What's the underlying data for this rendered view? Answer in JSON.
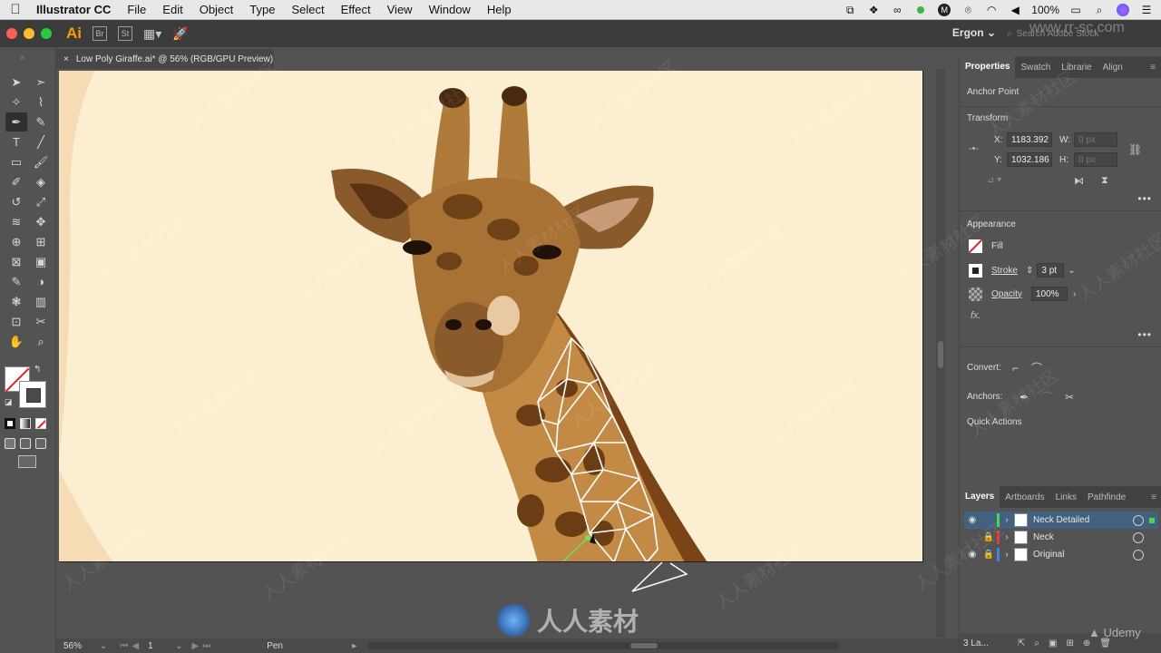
{
  "menubar": {
    "apple": "",
    "app_name": "Illustrator CC",
    "items": [
      "File",
      "Edit",
      "Object",
      "Type",
      "Select",
      "Effect",
      "View",
      "Window",
      "Help"
    ],
    "battery": "100%"
  },
  "appbar": {
    "logo": "Ai",
    "bridge": "Br",
    "stock": "St",
    "workspace": "Ergon",
    "search_placeholder": "Search Adobe Stock"
  },
  "document": {
    "tab_title": "Low Poly Giraffe.ai* @ 56% (RGB/GPU Preview)",
    "close": "×"
  },
  "toolbar": {
    "tools": [
      "selection-icon",
      "direct-selection-icon",
      "magic-wand-icon",
      "lasso-icon",
      "pen-icon",
      "curvature-icon",
      "type-icon",
      "line-icon",
      "rectangle-icon",
      "paintbrush-icon",
      "shaper-icon",
      "eraser-icon",
      "rotate-icon",
      "scale-icon",
      "width-icon",
      "puppet-warp-icon",
      "shape-builder-icon",
      "perspective-icon",
      "mesh-icon",
      "gradient-icon",
      "eyedropper-icon",
      "blend-icon",
      "symbol-sprayer-icon",
      "graph-icon",
      "artboard-icon",
      "slice-icon",
      "hand-icon",
      "zoom-icon"
    ],
    "glyphs": [
      "➤",
      "➣",
      "✧",
      "⌇",
      "✒",
      "✎",
      "T",
      "╱",
      "▭",
      "🖌",
      "✐",
      "◈",
      "↺",
      "⤢",
      "≋",
      "✥",
      "⊕",
      "⊞",
      "⊠",
      "▣",
      "✎",
      "◑",
      "❃",
      "▥",
      "⊡",
      "✂",
      "✋",
      "⌕"
    ]
  },
  "properties": {
    "tabs": [
      "Properties",
      "Swatches",
      "Libraries",
      "Align"
    ],
    "tabs_shown": [
      "Properties",
      "Swatch",
      "Librarie",
      "Align"
    ],
    "object_type": "Anchor Point",
    "transform": {
      "title": "Transform",
      "x_label": "X:",
      "x_value": "1183.392",
      "y_label": "Y:",
      "y_value": "1032.186",
      "w_label": "W:",
      "w_value": "0 px",
      "h_label": "H:",
      "h_value": "0 px"
    },
    "appearance": {
      "title": "Appearance",
      "fill_label": "Fill",
      "stroke_label": "Stroke",
      "stroke_value": "3 pt",
      "opacity_label": "Opacity",
      "opacity_value": "100%",
      "fx": "fx."
    },
    "convert_label": "Convert:",
    "anchors_label": "Anchors:",
    "quick_actions": "Quick Actions",
    "more": "•••"
  },
  "layers": {
    "tabs": [
      "Layers",
      "Artboards",
      "Links",
      "Pathfinder"
    ],
    "tabs_shown": [
      "Layers",
      "Artboards",
      "Links",
      "Pathfinde"
    ],
    "items": [
      {
        "name": "Neck Detailed",
        "color": "#4fd24f",
        "visible": true,
        "locked": false,
        "selected": true
      },
      {
        "name": "Neck",
        "color": "#e23b3b",
        "visible": false,
        "locked": true,
        "selected": false
      },
      {
        "name": "Original",
        "color": "#4a7fe0",
        "visible": true,
        "locked": true,
        "selected": false
      }
    ],
    "count": "3 La..."
  },
  "statusbar": {
    "zoom": "56%",
    "artboard": "1",
    "tool": "Pen"
  },
  "watermark": {
    "text": "人人素材社区",
    "center_text": "人人素材",
    "site": "www.rr-sc.com",
    "udemy": "Udemy"
  },
  "colors": {
    "artboard": "#fcefd1",
    "accent_selection": "#41617e",
    "ai_orange": "#ff9a00"
  }
}
